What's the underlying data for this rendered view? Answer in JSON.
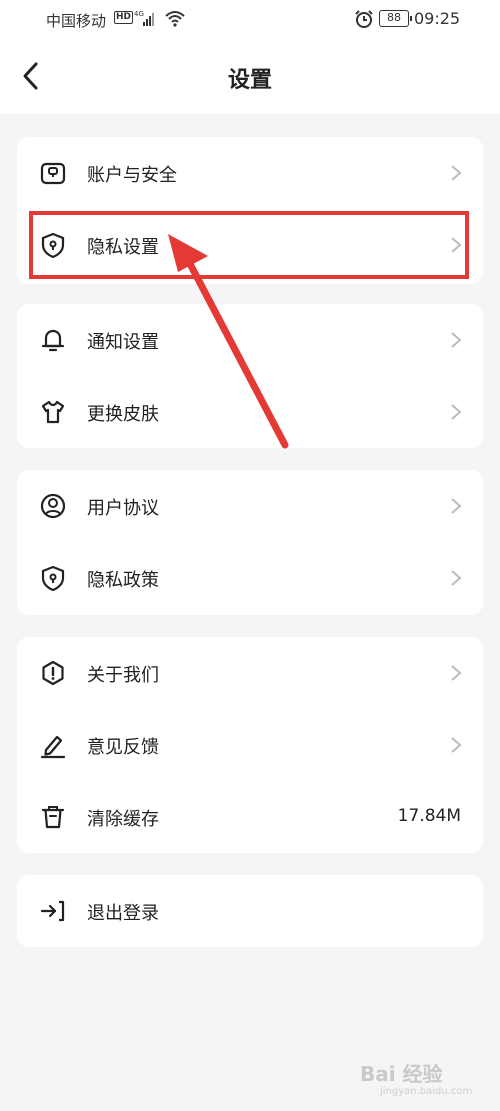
{
  "status": {
    "carrier": "中国移动",
    "hd": "HD",
    "battery": "88",
    "time": "09:25"
  },
  "nav": {
    "title": "设置"
  },
  "groups": [
    {
      "items": [
        {
          "label": "账户与安全",
          "icon": "account-lock-icon"
        },
        {
          "label": "隐私设置",
          "icon": "shield-icon"
        }
      ]
    },
    {
      "items": [
        {
          "label": "通知设置",
          "icon": "bell-icon"
        },
        {
          "label": "更换皮肤",
          "icon": "tshirt-icon"
        }
      ]
    },
    {
      "items": [
        {
          "label": "用户协议",
          "icon": "user-circle-icon"
        },
        {
          "label": "隐私政策",
          "icon": "shield-icon"
        }
      ]
    },
    {
      "items": [
        {
          "label": "关于我们",
          "icon": "info-icon"
        },
        {
          "label": "意见反馈",
          "icon": "pen-icon"
        },
        {
          "label": "清除缓存",
          "icon": "trash-icon",
          "value": "17.84M"
        }
      ]
    },
    {
      "items": [
        {
          "label": "退出登录",
          "icon": "logout-icon"
        }
      ]
    }
  ],
  "annotation": {
    "color": "#e53935"
  },
  "watermark": {
    "brand": "Bai 经验",
    "url": "jingyan.baidu.com"
  }
}
